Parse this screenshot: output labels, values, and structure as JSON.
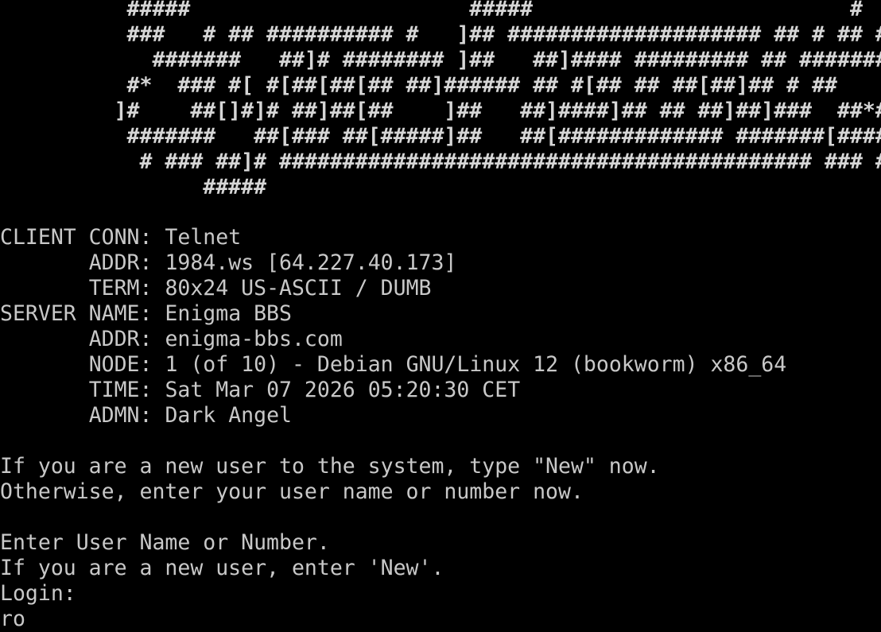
{
  "banner": [
    "          #####                      #####                         #",
    "          ###   # ## ########## #   ]## #################### ## # ## #",
    "            #######   ##]# ######## ]##   ##]#### ######### ## #########",
    "          #*  ### #[ #[##[##[## ##]###### ## #[## ## ##[##]## # ##",
    "         ]#    ##[]#]# ##]##[##    ]##   ##]####]## ## ##]##]###  ##*##",
    "          #######   ##[### ##[#####]##   ##[############# #######[#####",
    "           # ### ##]# ########################################## ### #",
    "                #####"
  ],
  "client": {
    "conn_label": "CLIENT CONN:",
    "conn_value": "Telnet",
    "addr_label": "ADDR:",
    "addr_value": "1984.ws [64.227.40.173]",
    "term_label": "TERM:",
    "term_value": "80x24 US-ASCII / DUMB"
  },
  "server": {
    "name_label": "SERVER NAME:",
    "name_value": "Enigma BBS",
    "addr_label": "ADDR:",
    "addr_value": "enigma-bbs.com",
    "node_label": "NODE:",
    "node_value": "1 (of 10) - Debian GNU/Linux 12 (bookworm) x86_64",
    "time_label": "TIME:",
    "time_value": "Sat Mar 07 2026 05:20:30 CET",
    "admin_label": "ADMN:",
    "admin_value": "Dark Angel"
  },
  "prompt": {
    "line1": "If you are a new user to the system, type \"New\" now.",
    "line2": "Otherwise, enter your user name or number now.",
    "line3": "Enter User Name or Number.",
    "line4": "If you are a new user, enter 'New'.",
    "login_label": "Login:",
    "input_value": "ro"
  }
}
